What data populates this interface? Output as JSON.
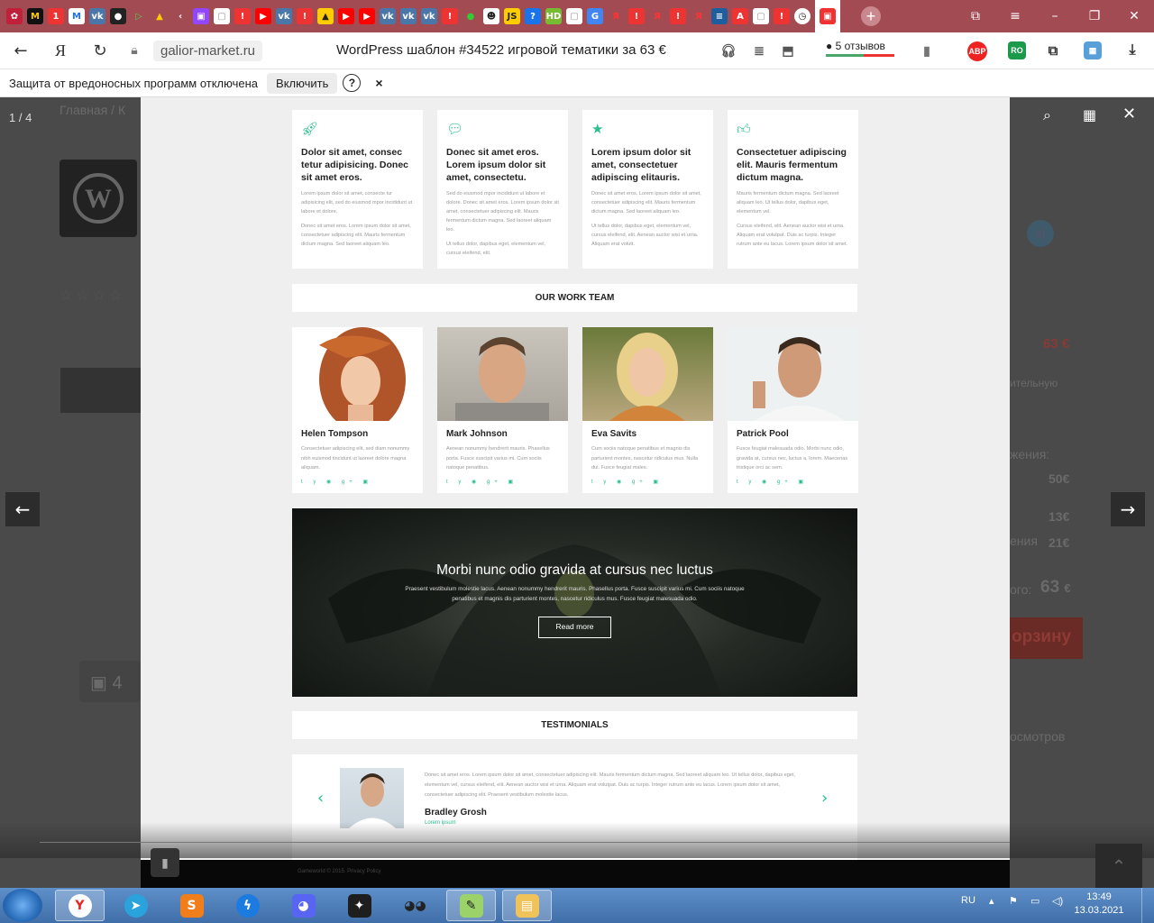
{
  "browser": {
    "url": "galior-market.ru",
    "page_title": "WordPress шаблон #34522 игровой тематики за 63 €",
    "reviews": "5 отзывов",
    "yandex_letter": "Я"
  },
  "infobar": {
    "message": "Защита от вредоносных программ отключена",
    "enable_label": "Включить",
    "help_symbol": "?",
    "close_symbol": "×"
  },
  "viewer": {
    "counter": "1 / 4"
  },
  "background_page": {
    "breadcrumb": "Главная  /  К",
    "price_top": "63 €",
    "text_partial1": "ительную",
    "text_partial2": "жения:",
    "price_50": "50€",
    "price_13": "13€",
    "text_partial3": "ения",
    "price_21": "21€",
    "text_partial4": "ого:",
    "price_total": "63",
    "price_total_currency": "€",
    "cart_partial": "орзину",
    "views_partial": "осмотров",
    "photo_count_partial": "4"
  },
  "features": [
    {
      "icon": "rocket-icon",
      "title": "Dolor sit amet, consec tetur adipisicing. Donec sit amet eros.",
      "text1": "Lorem ipsum dolor sit amet, consecte tur adipisicing elit, sed do eiusmod mpor incididunt ut labore et dolore.",
      "text2": "Donec sit amet eros. Lorem ipsum dolor sit amet, consectetuer adipiscing elit. Mauris fermentum dictum magna. Sed laoreet aliquam leo."
    },
    {
      "icon": "chat-icon",
      "title": "Donec sit amet eros. Lorem ipsum dolor sit amet, consectetu.",
      "text1": "Sed do eiusmod mpor incididunt ut labore et dolore. Donec sit amet eros. Lorem ipsum dolor sit amet, consectetuer adipiscing elit. Mauris fermentum dictum magna. Sed laoreet aliquam leo.",
      "text2": "Ut tellus dolor, dapibus eget, elementum vel, cursus eleifend, elit."
    },
    {
      "icon": "star-icon",
      "title": "Lorem ipsum dolor sit amet, consectetuer adipiscing elitauris.",
      "text1": "Donec sit amet eros. Lorem ipsum dolor sit amet, consectetuer adipiscing elit. Mauris fermentum dictum magna. Sed laoreet aliquam leo.",
      "text2": "Ut tellus dolor, dapibus eget, elementum vel, cursus eleifend, elit. Aenean auctor wisi et urna. Aliquam erat volutt."
    },
    {
      "icon": "thumbs-up-icon",
      "title": "Consectetuer adipiscing elit. Mauris fermentum dictum magna.",
      "text1": "Mauris fermentum dictum magna. Sed laoreet aliquam leo. Ut tellus dolor, dapibus eget, elementum vel.",
      "text2": "Cursus eleifend, elit. Aenean auctor wisi et urna. Aliquam erat volutpat. Duis ac turpis. Integer rutrum ante eu lacus. Lorem ipsum dolor sit amet."
    }
  ],
  "team_heading": "OUR WORK TEAM",
  "team": [
    {
      "name": "Helen Tompson",
      "text": "Consectetuer adipiscing elit, sed diam nonummy nibh euismod tincidunt ut laoreet dolore magna aliquam."
    },
    {
      "name": "Mark Johnson",
      "text": "Aenean nonummy hendrerit mauris. Phasellus porta. Fusce suscipit varius mi. Cum sociis natoque penatibus."
    },
    {
      "name": "Eva Savits",
      "text": "Cum sociis natoque penatibus et magnis dis parturient montes, nascetur ridiculus mus. Nulla dui. Fusce feugiat males."
    },
    {
      "name": "Patrick Pool",
      "text": "Fusce feugiat malesuada odio. Morbi nunc odio, gravida at, cursus nec, luctus a, lorem. Maecenas tristique orci ac sem."
    }
  ],
  "social_glyphs": "t y ◉ g+ ▣",
  "banner": {
    "title": "Morbi nunc odio gravida at cursus nec luctus",
    "text": "Praesent vestibulum molestie lacus. Aenean nonummy hendrerit mauris. Phasellus porta. Fusce suscipit varius mi. Cum sociis natoque penatibus et magnis dis parturient montes, nascetur ridiculus mus. Fusce feugiat malesuada odio.",
    "button": "Read more"
  },
  "testimonials_heading": "TESTIMONIALS",
  "testimonial": {
    "text": "Donec sit amet eros. Lorem ipsum dolor sit amet, consectetuer adipiscing elit. Mauris fermentum dictum magna. Sed laoreet aliquam leo. Ut tellus dolor, dapibus eget, elementum vel, cursus eleifend, elit. Aenean auctor wisi et urna. Aliquam erat volutpat. Duis ac turpis. Integer rutrum ante eu lacus. Lorem ipsum dolor sit amet, consectetuer adipiscing elit. Praesent vestibulum molestie lacus.",
    "name": "Bradley Grosh",
    "role": "Lorem ipsum",
    "prev": "‹",
    "next": "›"
  },
  "footer_text": "Gameworld © 2015. Privacy Policy",
  "taskbar": {
    "lang": "RU",
    "time": "13:49",
    "date": "13.03.2021"
  },
  "colors": {
    "accent": "#2bbf8e",
    "tabbar": "#a24b53",
    "price_red": "#c0392b"
  }
}
